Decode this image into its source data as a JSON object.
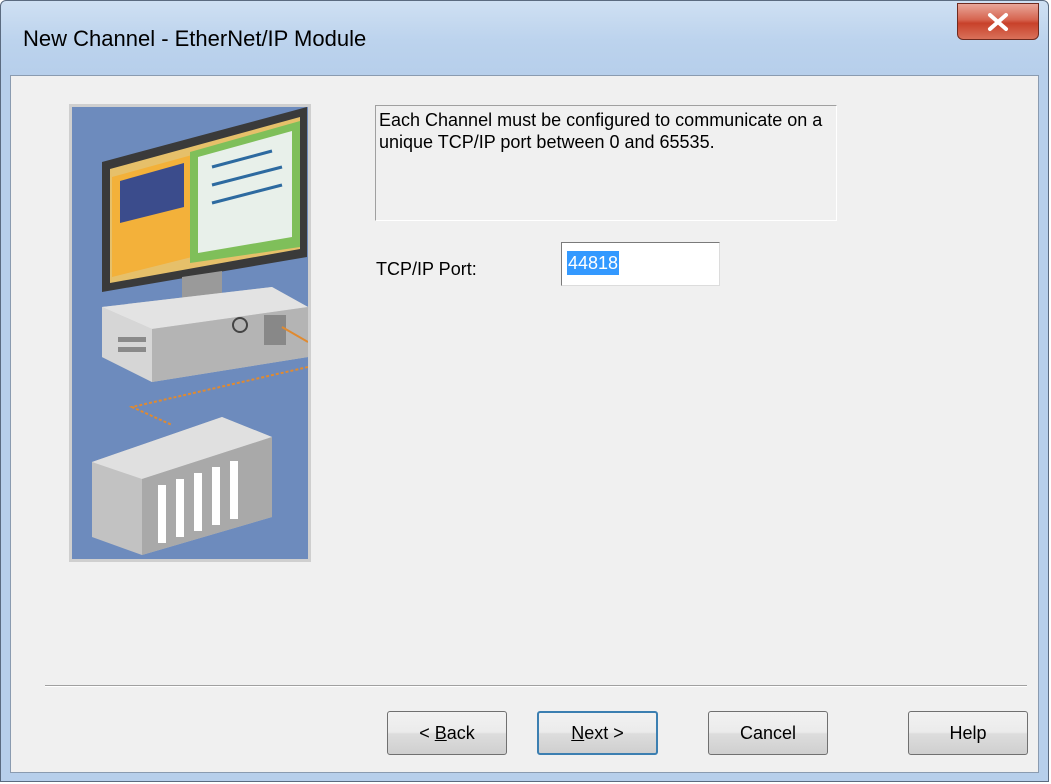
{
  "window": {
    "title": "New Channel - EtherNet/IP Module"
  },
  "description": "Each Channel must be configured to communicate on a unique TCP/IP port between 0 and 65535.",
  "port": {
    "label": "TCP/IP Port:",
    "value": "44818"
  },
  "buttons": {
    "back_prefix": "< ",
    "back_mnemonic": "B",
    "back_rest": "ack",
    "next_mnemonic": "N",
    "next_rest": "ext >",
    "cancel": "Cancel",
    "help": "Help"
  },
  "colors": {
    "illustration_bg": "#6d8bbd",
    "selection": "#3399ff",
    "close_button": "#c8412a"
  },
  "icons": {
    "close": "close-icon",
    "illustration": "computer-and-plc-illustration"
  }
}
